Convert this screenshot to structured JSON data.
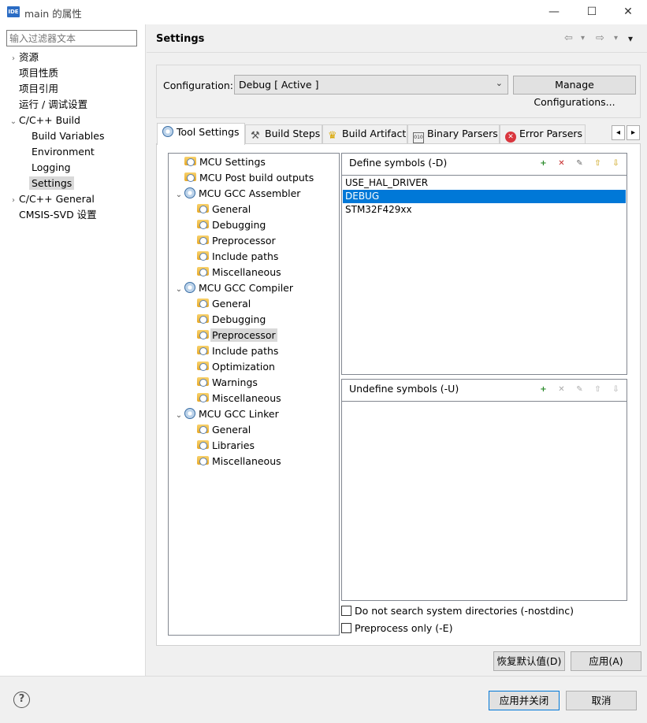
{
  "window": {
    "icon_text": "IDE",
    "title": "main 的属性",
    "minimize": "—",
    "maximize": "☐",
    "close": "✕"
  },
  "filter": {
    "placeholder": "输入过滤器文本"
  },
  "nav": [
    {
      "label": "资源",
      "chevron": "›",
      "indent": 0
    },
    {
      "label": "项目性质",
      "chevron": "",
      "indent": 0
    },
    {
      "label": "项目引用",
      "chevron": "",
      "indent": 0
    },
    {
      "label": "运行 / 调试设置",
      "chevron": "",
      "indent": 0
    },
    {
      "label": "C/C++ Build",
      "chevron": "⌄",
      "indent": 0
    },
    {
      "label": "Build Variables",
      "chevron": "",
      "indent": 1
    },
    {
      "label": "Environment",
      "chevron": "",
      "indent": 1
    },
    {
      "label": "Logging",
      "chevron": "",
      "indent": 1
    },
    {
      "label": "Settings",
      "chevron": "",
      "indent": 1,
      "selected": true
    },
    {
      "label": "C/C++ General",
      "chevron": "›",
      "indent": 0
    },
    {
      "label": "CMSIS-SVD 设置",
      "chevron": "",
      "indent": 0
    }
  ],
  "header": {
    "title": "Settings",
    "back": "⇦",
    "forward": "⇨",
    "dropdown": "▾",
    "menu": "▾"
  },
  "config": {
    "label": "Configuration:",
    "value": "Debug  [ Active ]",
    "caret": "⌄",
    "manage_label": "Manage Configurations..."
  },
  "tabs": [
    {
      "label": "Tool Settings",
      "icon": "gear-icon",
      "active": true
    },
    {
      "label": "Build Steps",
      "icon": "wand-icon"
    },
    {
      "label": "Build Artifact",
      "icon": "trophy-icon"
    },
    {
      "label": "Binary Parsers",
      "icon": "binary-icon"
    },
    {
      "label": "Error Parsers",
      "icon": "error-icon"
    }
  ],
  "tab_scroll": {
    "left": "◂",
    "right": "▸"
  },
  "tree": [
    {
      "label": "MCU Settings",
      "level": 0,
      "twisty": "",
      "icon": "folder"
    },
    {
      "label": "MCU Post build outputs",
      "level": 0,
      "twisty": "",
      "icon": "folder"
    },
    {
      "label": "MCU GCC Assembler",
      "level": 0,
      "twisty": "⌄",
      "icon": "gear"
    },
    {
      "label": "General",
      "level": 1,
      "icon": "folder"
    },
    {
      "label": "Debugging",
      "level": 1,
      "icon": "folder"
    },
    {
      "label": "Preprocessor",
      "level": 1,
      "icon": "folder"
    },
    {
      "label": "Include paths",
      "level": 1,
      "icon": "folder"
    },
    {
      "label": "Miscellaneous",
      "level": 1,
      "icon": "folder"
    },
    {
      "label": "MCU GCC Compiler",
      "level": 0,
      "twisty": "⌄",
      "icon": "gear"
    },
    {
      "label": "General",
      "level": 1,
      "icon": "folder"
    },
    {
      "label": "Debugging",
      "level": 1,
      "icon": "folder"
    },
    {
      "label": "Preprocessor",
      "level": 1,
      "icon": "folder",
      "selected": true
    },
    {
      "label": "Include paths",
      "level": 1,
      "icon": "folder"
    },
    {
      "label": "Optimization",
      "level": 1,
      "icon": "folder"
    },
    {
      "label": "Warnings",
      "level": 1,
      "icon": "folder"
    },
    {
      "label": "Miscellaneous",
      "level": 1,
      "icon": "folder"
    },
    {
      "label": "MCU GCC Linker",
      "level": 0,
      "twisty": "⌄",
      "icon": "gear"
    },
    {
      "label": "General",
      "level": 1,
      "icon": "folder"
    },
    {
      "label": "Libraries",
      "level": 1,
      "icon": "folder"
    },
    {
      "label": "Miscellaneous",
      "level": 1,
      "icon": "folder"
    }
  ],
  "define": {
    "title": "Define symbols (-D)",
    "symbols": [
      "USE_HAL_DRIVER",
      "DEBUG",
      "STM32F429xx"
    ],
    "selected_index": 1,
    "tools": [
      "add-icon",
      "delete-icon",
      "edit-icon",
      "move-up-icon",
      "move-down-icon"
    ]
  },
  "undefine": {
    "title": "Undefine symbols (-U)",
    "symbols": []
  },
  "options": {
    "nostdinc_label": "Do not search system directories (-nostdinc)",
    "preprocess_only_label": "Preprocess only (-E)"
  },
  "buttons": {
    "restore_defaults": "恢复默认值(D)",
    "apply": "应用(A)",
    "apply_close": "应用并关闭",
    "cancel": "取消",
    "help": "?"
  },
  "colors": {
    "selection": "#0078d7",
    "primary_border": "#0078d7"
  }
}
